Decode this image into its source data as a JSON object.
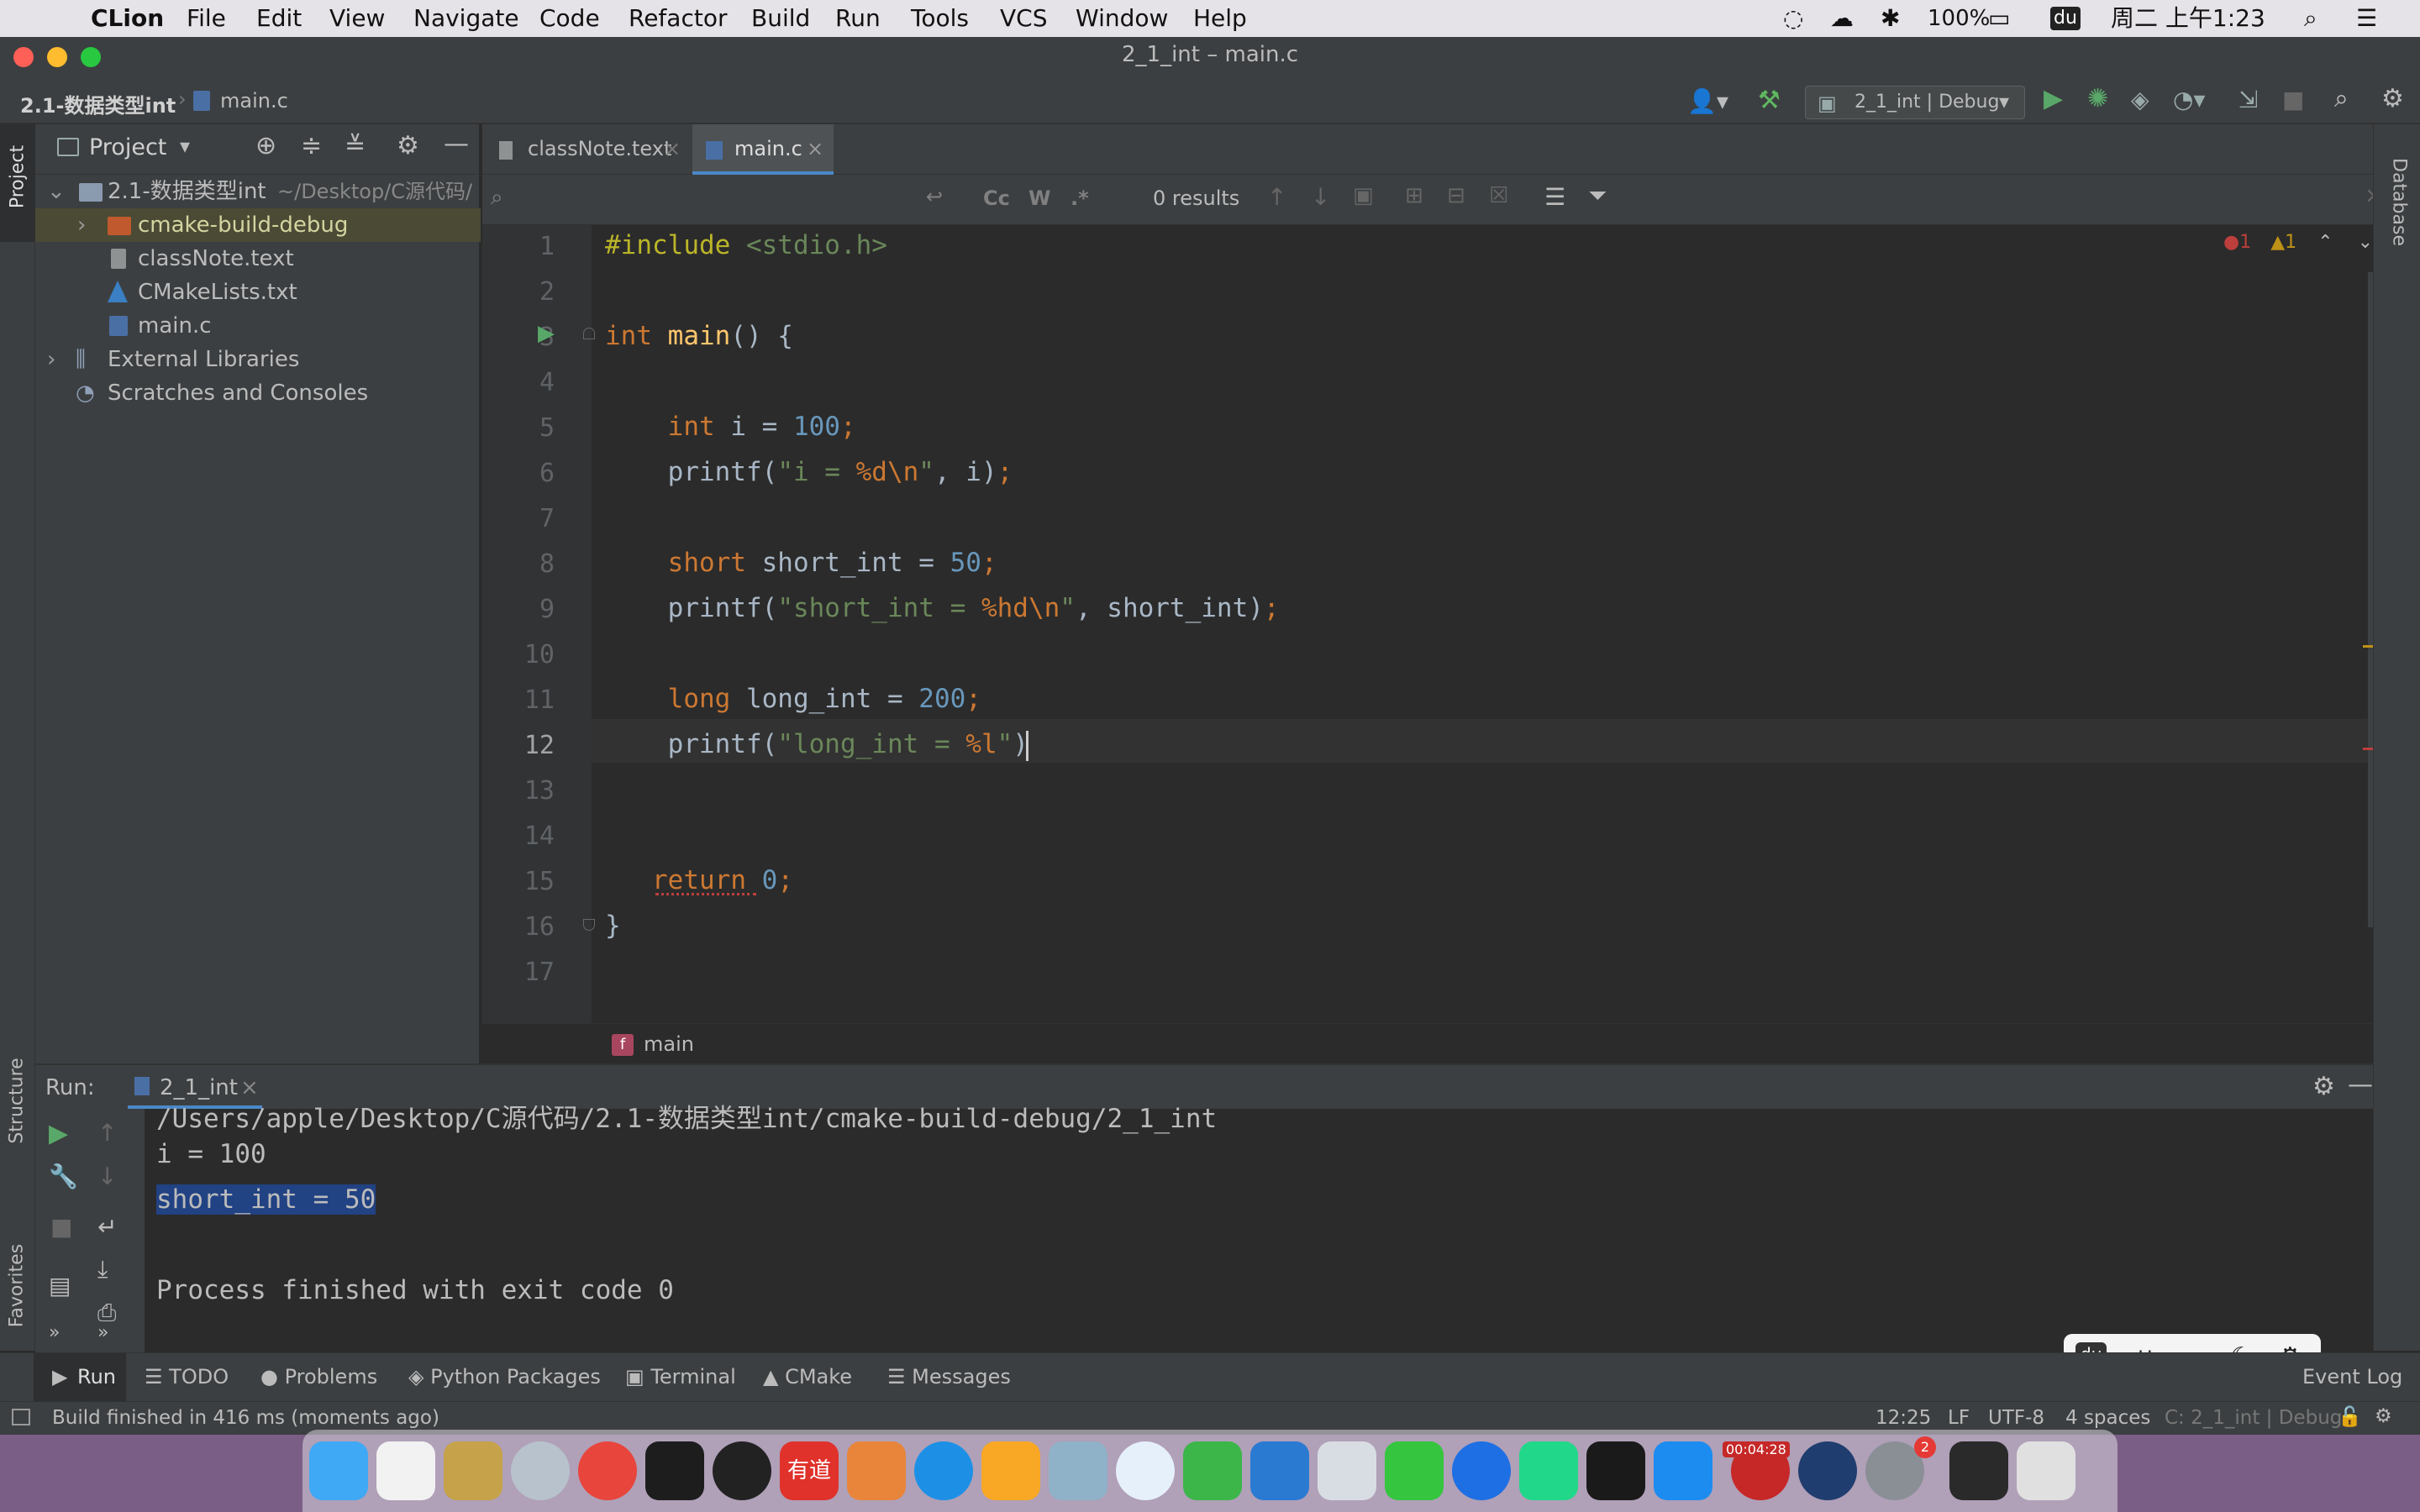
{
  "menubar": {
    "app": "CLion",
    "items": [
      "File",
      "Edit",
      "View",
      "Navigate",
      "Code",
      "Refactor",
      "Build",
      "Run",
      "Tools",
      "VCS",
      "Window",
      "Help"
    ],
    "battery": "100%",
    "clock": "周二 上午1:23"
  },
  "window": {
    "title": "2_1_int – main.c"
  },
  "navbar": {
    "project": "2.1-数据类型int",
    "file": "main.c",
    "run_config": "2_1_int | Debug"
  },
  "project_panel": {
    "title": "Project",
    "tree": [
      {
        "label": "2.1-数据类型int",
        "path": "~/Desktop/C源代码/"
      },
      {
        "label": "cmake-build-debug"
      },
      {
        "label": "classNote.text"
      },
      {
        "label": "CMakeLists.txt"
      },
      {
        "label": "main.c"
      },
      {
        "label": "External Libraries"
      },
      {
        "label": "Scratches and Consoles"
      }
    ]
  },
  "editor": {
    "tabs": [
      {
        "label": "classNote.text"
      },
      {
        "label": "main.c"
      }
    ],
    "find": {
      "results": "0 results",
      "case": "Cc",
      "word": "W",
      "regex": ".*"
    },
    "inspections": {
      "errors": "1",
      "warnings": "1"
    },
    "line_numbers": [
      "1",
      "2",
      "3",
      "4",
      "5",
      "6",
      "7",
      "8",
      "9",
      "10",
      "11",
      "12",
      "13",
      "14",
      "15",
      "16",
      "17"
    ],
    "lines": [
      [
        {
          "t": "#include ",
          "c": "pp"
        },
        {
          "t": "<stdio.h>",
          "c": "str"
        }
      ],
      [],
      [
        {
          "t": "int ",
          "c": "kw"
        },
        {
          "t": "main",
          "c": "fn"
        },
        {
          "t": "() {",
          "c": ""
        }
      ],
      [],
      [
        {
          "t": "    ",
          "c": ""
        },
        {
          "t": "int ",
          "c": "kw"
        },
        {
          "t": "i = ",
          "c": ""
        },
        {
          "t": "100",
          "c": "num"
        },
        {
          "t": ";",
          "c": "kw"
        }
      ],
      [
        {
          "t": "    printf(",
          "c": ""
        },
        {
          "t": "\"i = ",
          "c": "str"
        },
        {
          "t": "%d",
          "c": "esc"
        },
        {
          "t": "\\n",
          "c": "esc"
        },
        {
          "t": "\"",
          "c": "str"
        },
        {
          "t": ", i)",
          "c": ""
        },
        {
          "t": ";",
          "c": "kw"
        }
      ],
      [],
      [
        {
          "t": "    ",
          "c": ""
        },
        {
          "t": "short ",
          "c": "kw"
        },
        {
          "t": "short_int = ",
          "c": ""
        },
        {
          "t": "50",
          "c": "num"
        },
        {
          "t": ";",
          "c": "kw"
        }
      ],
      [
        {
          "t": "    printf(",
          "c": ""
        },
        {
          "t": "\"short_int = ",
          "c": "str"
        },
        {
          "t": "%hd",
          "c": "esc"
        },
        {
          "t": "\\n",
          "c": "esc"
        },
        {
          "t": "\"",
          "c": "str"
        },
        {
          "t": ", short_int)",
          "c": ""
        },
        {
          "t": ";",
          "c": "kw"
        }
      ],
      [],
      [
        {
          "t": "    ",
          "c": ""
        },
        {
          "t": "long ",
          "c": "kw"
        },
        {
          "t": "long_int = ",
          "c": ""
        },
        {
          "t": "200",
          "c": "num"
        },
        {
          "t": ";",
          "c": "kw"
        }
      ],
      [
        {
          "t": "    printf(",
          "c": ""
        },
        {
          "t": "\"long_int = ",
          "c": "str"
        },
        {
          "t": "%l",
          "c": "esc"
        },
        {
          "t": "\"",
          "c": "str"
        },
        {
          "t": ")",
          "c": ""
        }
      ],
      [],
      [],
      [
        {
          "t": "   ",
          "c": ""
        },
        {
          "t": "return ",
          "c": "kw"
        },
        {
          "t": "0",
          "c": "num"
        },
        {
          "t": ";",
          "c": "kw"
        }
      ],
      [
        {
          "t": "}",
          "c": ""
        }
      ],
      []
    ],
    "breadcrumb": "main"
  },
  "run_panel": {
    "label": "Run:",
    "tab": "2_1_int",
    "console": [
      "/Users/apple/Desktop/C源代码/2.1-数据类型int/cmake-build-debug/2_1_int",
      "i = 100",
      "short_int = 50",
      "",
      "Process finished with exit code 0"
    ]
  },
  "tool_tabs": [
    "Run",
    "TODO",
    "Problems",
    "Python Packages",
    "Terminal",
    "CMake",
    "Messages"
  ],
  "event_log": "Event Log",
  "side_tabs": {
    "left_top": "Project",
    "left_mid": "Structure",
    "left_bottom": "Favorites",
    "right": "Database"
  },
  "status": {
    "message": "Build finished in 416 ms (moments ago)",
    "position": "12:25",
    "line_sep": "LF",
    "encoding": "UTF-8",
    "indent": "4 spaces",
    "context": "C: 2_1_int | Debug"
  },
  "ime": {
    "lang": "英",
    "punct": "；"
  },
  "dock": {
    "clion_badge": "00:04:28",
    "prefs_badge": "2"
  }
}
